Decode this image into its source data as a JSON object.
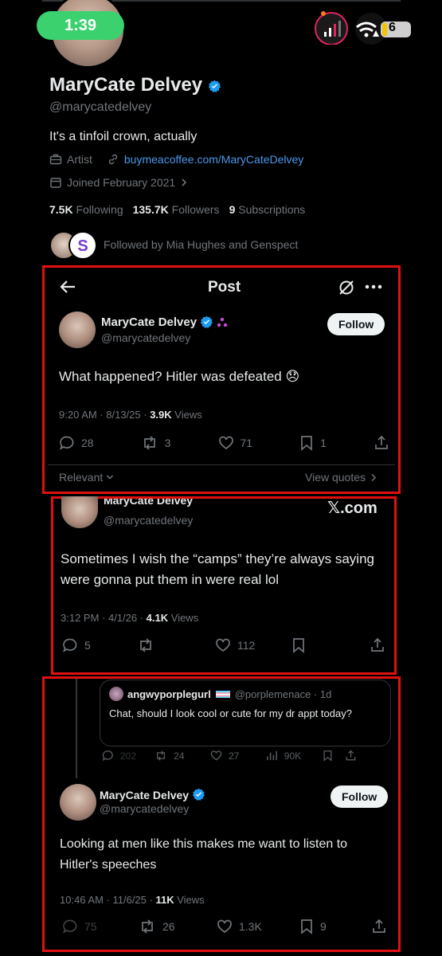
{
  "status": {
    "time": "1:39",
    "battery": "6"
  },
  "profile": {
    "name": "MaryCate Delvey",
    "handle": "@marycatedelvey",
    "bio": "It's a tinfoil crown, actually",
    "category": "Artist",
    "link": "buymeacoffee.com/MaryCateDelvey",
    "joined": "Joined February 2021",
    "following_count": "7.5K",
    "following_label": "Following",
    "followers_count": "135.7K",
    "followers_label": "Followers",
    "subs_count": "9",
    "subs_label": "Subscriptions",
    "followed_by": "Followed by Mia Hughes and Genspect"
  },
  "post1": {
    "header_title": "Post",
    "name": "MaryCate Delvey",
    "handle": "@marycatedelvey",
    "follow_label": "Follow",
    "text": "What happened? Hitler was defeated 😞",
    "time": "9:20 AM · 8/13/25 · ",
    "views_count": "3.9K",
    "views_label": " Views",
    "replies": "28",
    "reposts": "3",
    "likes": "71",
    "bookmarks": "1",
    "relevant": "Relevant",
    "view_quotes": "View quotes"
  },
  "post2": {
    "name": "MaryCate Delvey",
    "handle": "@marycatedelvey",
    "source": "𝕏.com",
    "text": "Sometimes I wish the “camps” they’re always saying were gonna put them in were real lol",
    "time": "3:12 PM · 4/1/26 · ",
    "views_count": "4.1K",
    "views_label": " Views",
    "replies": "5",
    "likes": "112"
  },
  "post3": {
    "quoted_name": "angwyporplegurl",
    "quoted_handle": "@porplemenace · 1d",
    "quoted_text": "Chat, should I look cool or cute for my dr appt today?",
    "quoted_replies": "202",
    "quoted_reposts": "24",
    "quoted_likes": "27",
    "quoted_views": "90K",
    "name": "MaryCate Delvey",
    "handle": "@marycatedelvey",
    "follow_label": "Follow",
    "text": "Looking at men like this makes me want to listen to Hitler's speeches",
    "time": "10:46 AM · 11/6/25 · ",
    "views_count": "11K",
    "views_label": " Views",
    "replies": "75",
    "reposts": "26",
    "likes": "1.3K",
    "bookmarks": "9"
  },
  "colors": {
    "accent_blue": "#1d9bf0",
    "status_green": "#3bd16f",
    "frame_red": "#e01010"
  }
}
